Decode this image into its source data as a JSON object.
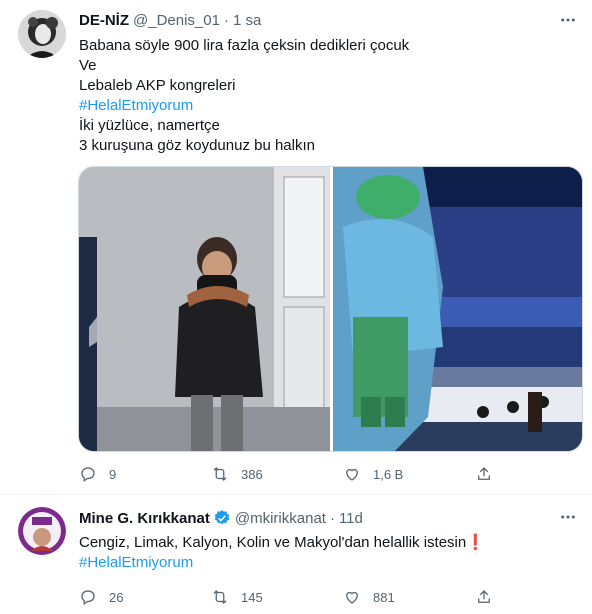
{
  "tweets": [
    {
      "name": "DE-NİZ",
      "handle": "@_Denis_01",
      "time": "1 sa",
      "lines": [
        "Babana söyle 900 lira fazla çeksin dedikleri çocuk",
        "Ve",
        "Lebaleb AKP kongreleri",
        "#HelalEtmiyorum",
        "İki yüzlüce, namertçe",
        "3 kuruşuna göz koydunuz bu halkın"
      ],
      "replies": "9",
      "retweets": "386",
      "likes": "1,6 B"
    },
    {
      "name": "Mine G. Kırıkkanat",
      "handle": "@mkirikkanat",
      "time": "11d",
      "lines": [
        "Cengiz, Limak, Kalyon, Kolin ve Makyol'dan helallik istesin❗",
        "#HelalEtmiyorum"
      ],
      "replies": "26",
      "retweets": "145",
      "likes": "881"
    }
  ],
  "colors": {
    "accent": "#1d9bf0",
    "muted": "#536471",
    "text": "#0f1419"
  },
  "icons": [
    "more-icon",
    "reply-icon",
    "retweet-icon",
    "like-icon",
    "share-icon",
    "verified-icon"
  ]
}
